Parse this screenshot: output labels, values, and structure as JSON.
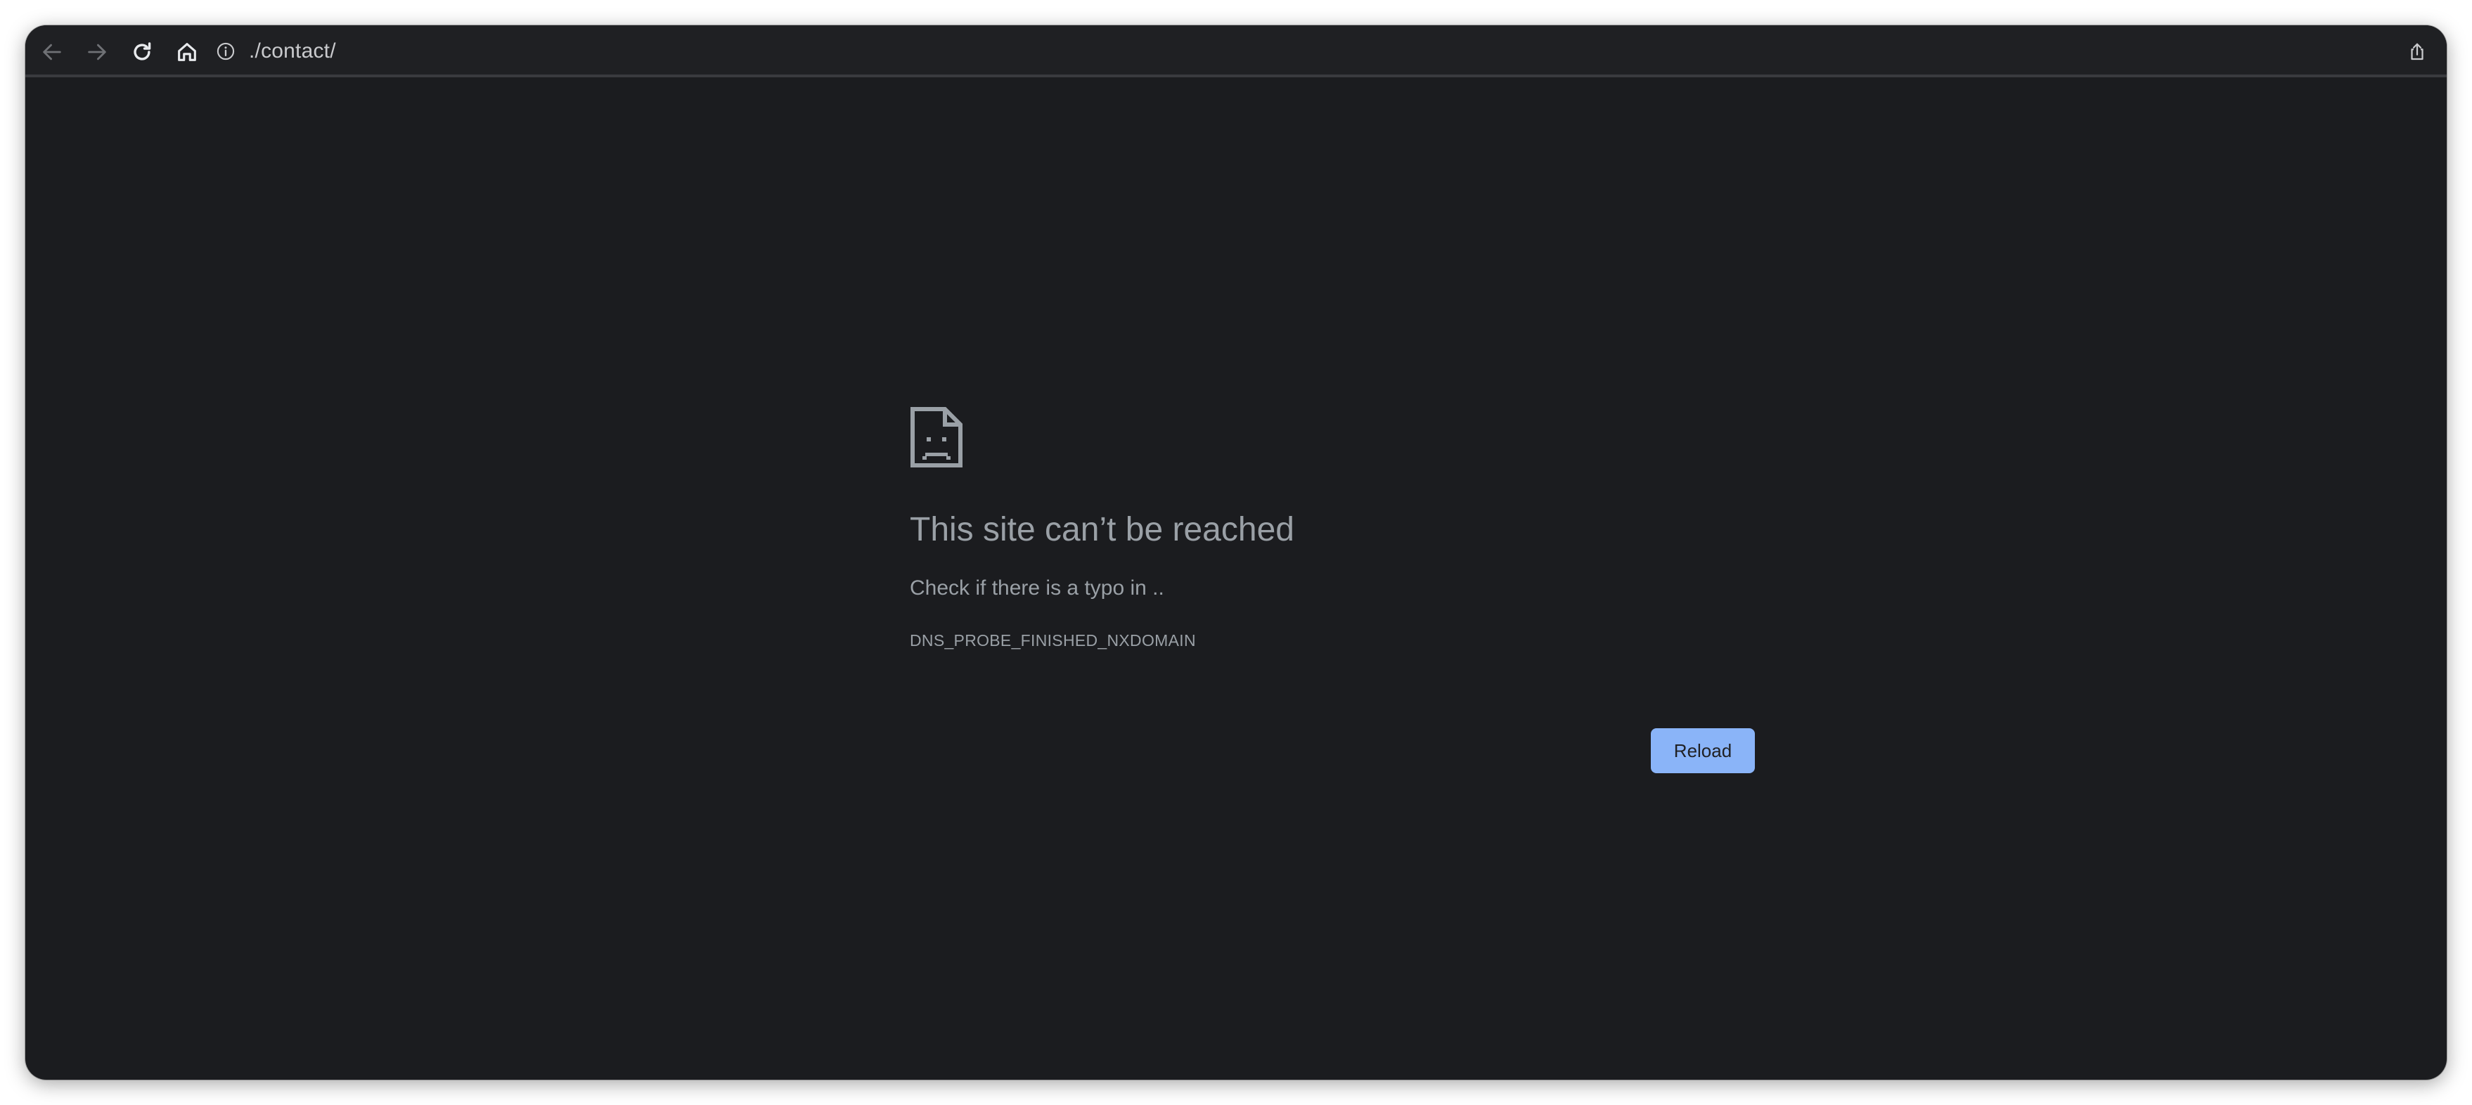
{
  "toolbar": {
    "back_icon": "arrow-left-icon",
    "forward_icon": "arrow-right-icon",
    "reload_icon": "reload-icon",
    "home_icon": "home-icon",
    "info_icon": "info-circle-icon",
    "url": "./contact/",
    "share_icon": "share-icon"
  },
  "error_page": {
    "icon": "sad-document-icon",
    "title": "This site can’t be reached",
    "description": "Check if there is a typo in ..",
    "code": "DNS_PROBE_FINISHED_NXDOMAIN",
    "reload_label": "Reload"
  },
  "colors": {
    "background": "#1b1c1f",
    "toolbar": "#1f2023",
    "text_muted": "#9aa0a6",
    "accent": "#8ab4f8"
  }
}
